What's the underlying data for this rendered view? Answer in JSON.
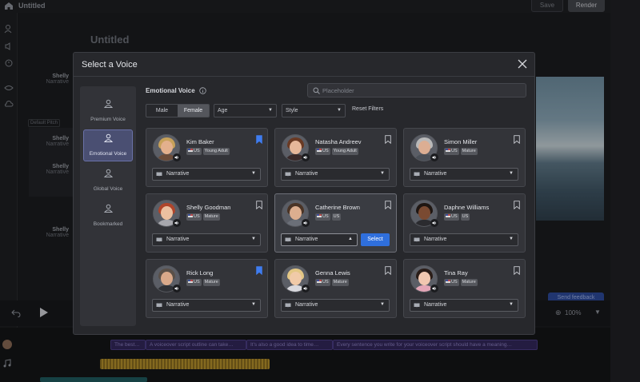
{
  "app": {
    "title": "Untitled",
    "document_title": "Untitled",
    "save_label": "Save",
    "render_label": "Render",
    "feedback_label": "Send feedback",
    "zoom": "100%",
    "pitch_chip": "Default Pitch",
    "bg_voices": [
      {
        "name": "Shelly",
        "style": "Narrative"
      },
      {
        "name": "Shelly",
        "style": "Narrative"
      },
      {
        "name": "Shelly",
        "style": "Narrative"
      },
      {
        "name": "Shelly",
        "style": "Narrative"
      }
    ],
    "timeline_clips": [
      "The best…",
      "A voiceover script outline can take…",
      "It's also a good idea to time…",
      "Every sentence you write for your voiceover script should have a meaning…"
    ]
  },
  "modal": {
    "title": "Select a Voice",
    "sidebar": [
      {
        "label": "Premium Voice",
        "active": false
      },
      {
        "label": "Emotional Voice",
        "active": true
      },
      {
        "label": "Global Voice",
        "active": false
      },
      {
        "label": "Bookmarked",
        "active": false
      }
    ],
    "section_title": "Emotional Voice",
    "search_placeholder": "Placeholder",
    "filters": {
      "male": "Male",
      "female": "Female",
      "age": "Age",
      "style": "Style",
      "reset": "Reset Filters"
    },
    "select_label": "Select",
    "voices": [
      {
        "name": "Kim Baker",
        "tags": [
          "US",
          "Young Adult"
        ],
        "style": "Narrative",
        "bookmarked": true,
        "skin": "#e3b08d",
        "hair": "#c7a15a",
        "shirt": "#6b4c3a"
      },
      {
        "name": "Natasha Andreev",
        "tags": [
          "US",
          "Young Adult"
        ],
        "style": "Narrative",
        "bookmarked": false,
        "skin": "#e6b79a",
        "hair": "#6a3a24",
        "shirt": "#3a2a2a"
      },
      {
        "name": "Simon Miller",
        "tags": [
          "US",
          "Mature"
        ],
        "style": "Narrative",
        "bookmarked": false,
        "skin": "#dcae93",
        "hair": "#b9b9b9",
        "shirt": "#4a4f57"
      },
      {
        "name": "Shelly Goodman",
        "tags": [
          "US",
          "Mature"
        ],
        "style": "Narrative",
        "bookmarked": false,
        "skin": "#ecc0a0",
        "hair": "#b0452b",
        "shirt": "#a7a7ad"
      },
      {
        "name": "Catherine Brown",
        "tags": [
          "US",
          "US"
        ],
        "style": "Narrative",
        "bookmarked": false,
        "skin": "#dcae8f",
        "hair": "#4a3426",
        "shirt": "#6b6f78"
      },
      {
        "name": "Daphne Williams",
        "tags": [
          "US",
          "US"
        ],
        "style": "Narrative",
        "bookmarked": false,
        "skin": "#7a4a32",
        "hair": "#1f1612",
        "shirt": "#2b2b2f"
      },
      {
        "name": "Rick Long",
        "tags": [
          "US",
          "Mature"
        ],
        "style": "Narrative",
        "bookmarked": true,
        "skin": "#d9a98a",
        "hair": "#5a5048",
        "shirt": "#2f3136"
      },
      {
        "name": "Genna Lewis",
        "tags": [
          "US",
          "Mature"
        ],
        "style": "Narrative",
        "bookmarked": false,
        "skin": "#f0caa8",
        "hair": "#e3c785",
        "shirt": "#d9d9de"
      },
      {
        "name": "Tina Ray",
        "tags": [
          "US",
          "Mature"
        ],
        "style": "Narrative",
        "bookmarked": false,
        "skin": "#f1c7b0",
        "hair": "#2a1d18",
        "shirt": "#e4a6b7"
      }
    ],
    "hovered_index": 4,
    "colors": {
      "accent": "#2f6fdc",
      "bookmark_on": "#3f7cf0",
      "sidebar_active": "#4a4f72"
    }
  }
}
